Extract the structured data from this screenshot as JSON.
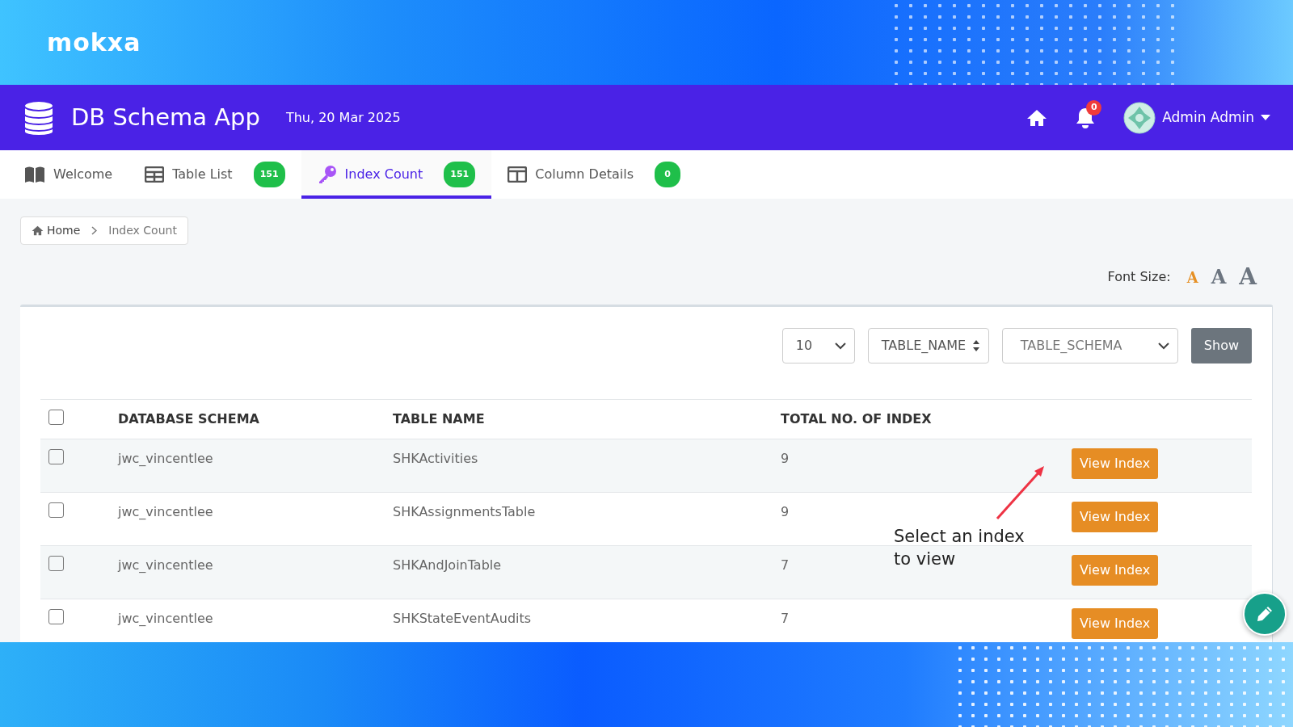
{
  "brand": {
    "logo": "mokxa"
  },
  "app_header": {
    "title": "DB Schema App",
    "date": "Thu, 20 Mar 2025",
    "notification_count": "0",
    "user_name": "Admin Admin"
  },
  "tabs": [
    {
      "label": "Welcome",
      "selected": false
    },
    {
      "label": "Table List",
      "badge": "151",
      "selected": false
    },
    {
      "label": "Index Count",
      "badge": "151",
      "selected": true
    },
    {
      "label": "Column Details",
      "badge": "0",
      "selected": false
    }
  ],
  "breadcrumb": [
    "Home",
    "Index Count"
  ],
  "font_size": {
    "label": "Font Size:",
    "options": [
      {
        "letter": "A",
        "selected": true
      },
      {
        "letter": "A",
        "selected": false
      },
      {
        "letter": "A",
        "selected": false
      }
    ]
  },
  "filters": {
    "page_size": "10",
    "sort_field": "TABLE_NAME",
    "schema_select": "TABLE_SCHEMA",
    "show_button": "Show"
  },
  "table": {
    "header_checked": false,
    "columns": [
      "DATABASE SCHEMA",
      "TABLE NAME",
      "TOTAL NO. OF INDEX"
    ],
    "rows": [
      {
        "checked": false,
        "schema": "jwc_vincentlee",
        "table_name": "SHKActivities",
        "total": "9",
        "action": "View Index"
      },
      {
        "checked": false,
        "schema": "jwc_vincentlee",
        "table_name": "SHKAssignmentsTable",
        "total": "9",
        "action": "View Index"
      },
      {
        "checked": false,
        "schema": "jwc_vincentlee",
        "table_name": "SHKAndJoinTable",
        "total": "7",
        "action": "View Index"
      },
      {
        "checked": false,
        "schema": "jwc_vincentlee",
        "table_name": "SHKStateEventAudits",
        "total": "7",
        "action": "View Index"
      }
    ]
  },
  "annotation": {
    "text": "Select an index to view"
  }
}
